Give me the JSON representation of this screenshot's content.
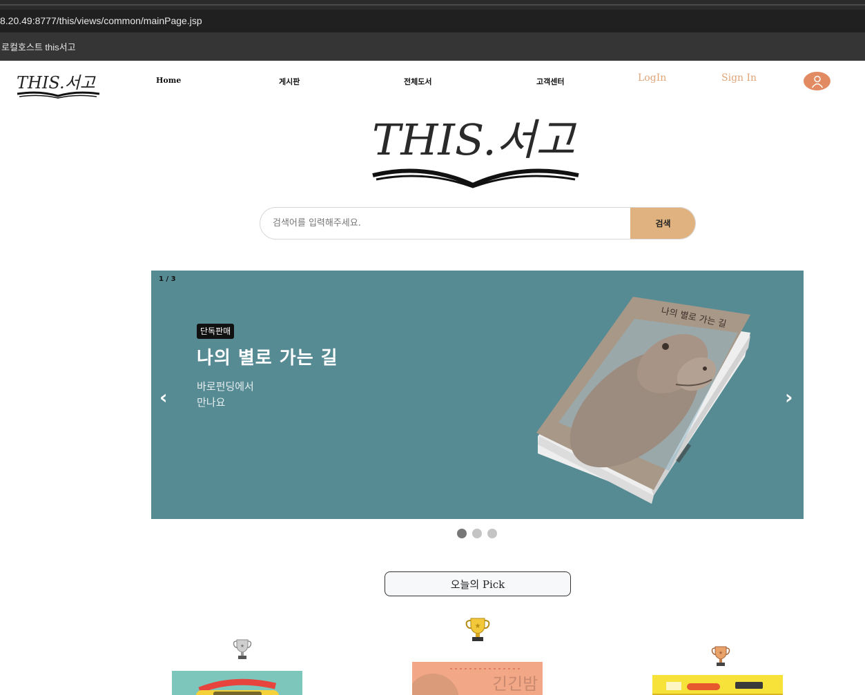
{
  "browser": {
    "url": "8.20.49:8777/this/views/common/mainPage.jsp",
    "bookmark": "로컬호스트 this서고"
  },
  "header": {
    "logo_text": "THIS.서고",
    "nav": [
      "Home",
      "게시판",
      "전체도서",
      "고객센터"
    ],
    "login_label": "LogIn",
    "signup_label": "Sign In"
  },
  "hero": {
    "logo_text": "THIS.서고"
  },
  "search": {
    "placeholder": "검색어를 입력해주세요.",
    "button_label": "검색"
  },
  "carousel": {
    "counter": "1 / 3",
    "badge": "단독판매",
    "title": "나의 별로 가는 길",
    "subtitle_line1": "바로펀딩에서",
    "subtitle_line2": "만나요",
    "book_cover_title": "나의 별로 가는 길",
    "prev_icon": "chevron-left-icon",
    "next_icon": "chevron-right-icon",
    "background_color": "#578b94",
    "current_slide": 1,
    "total_slides": 3
  },
  "pick": {
    "title": "오늘의 Pick",
    "books": [
      {
        "rank_icon": "silver-trophy-icon",
        "cover_text": ""
      },
      {
        "rank_icon": "gold-trophy-icon",
        "cover_text": "긴긴밤"
      },
      {
        "rank_icon": "bronze-trophy-icon",
        "cover_text": ""
      }
    ]
  },
  "colors": {
    "accent": "#dfb27f",
    "auth_link": "#e0a476",
    "avatar": "#e28a62"
  }
}
